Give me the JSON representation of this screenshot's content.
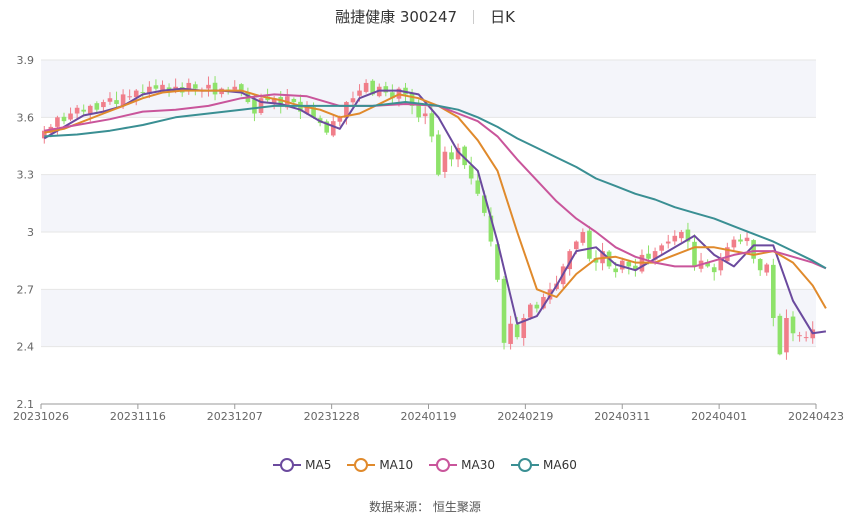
{
  "header": {
    "title": "融捷健康 300247",
    "period": "日K"
  },
  "source": "数据来源： 恒生聚源",
  "colors": {
    "up": "#f07e8a",
    "down": "#8ee26a",
    "grid": "#e6e6e6",
    "band": "#f4f5fa",
    "axis": "#9a9a9a",
    "text": "#666666"
  },
  "chart_data": {
    "type": "candlestick",
    "x_ticks": [
      "20231026",
      "20231116",
      "20231207",
      "20231228",
      "20240119",
      "20240219",
      "20240311",
      "20240401",
      "20240423"
    ],
    "ylim": [
      2.1,
      3.9
    ],
    "y_ticks": [
      "2.1",
      "2.4",
      "2.7",
      "3",
      "3.3",
      "3.6",
      "3.9"
    ],
    "grid": true,
    "legend_position": "bottom",
    "close": [
      3.53,
      3.55,
      3.6,
      3.58,
      3.62,
      3.65,
      3.63,
      3.66,
      3.64,
      3.68,
      3.7,
      3.67,
      3.72,
      3.71,
      3.74,
      3.73,
      3.76,
      3.75,
      3.77,
      3.74,
      3.76,
      3.73,
      3.78,
      3.75,
      3.74,
      3.77,
      3.72,
      3.75,
      3.74,
      3.76,
      3.73,
      3.68,
      3.62,
      3.7,
      3.69,
      3.7,
      3.66,
      3.71,
      3.68,
      3.63,
      3.66,
      3.6,
      3.57,
      3.52,
      3.58,
      3.6,
      3.68,
      3.7,
      3.74,
      3.78,
      3.72,
      3.76,
      3.73,
      3.7,
      3.75,
      3.72,
      3.66,
      3.6,
      3.62,
      3.5,
      3.3,
      3.42,
      3.38,
      3.44,
      3.35,
      3.28,
      3.2,
      3.1,
      2.95,
      2.75,
      2.42,
      2.52,
      2.45,
      2.55,
      2.62,
      2.6,
      2.66,
      2.7,
      2.73,
      2.82,
      2.9,
      2.95,
      3.0,
      2.86,
      2.84,
      2.9,
      2.82,
      2.79,
      2.85,
      2.82,
      2.8,
      2.88,
      2.86,
      2.9,
      2.93,
      2.95,
      2.98,
      3.0,
      2.95,
      2.82,
      2.85,
      2.82,
      2.79,
      2.86,
      2.92,
      2.96,
      2.95,
      2.97,
      2.86,
      2.8,
      2.83,
      2.55,
      2.36,
      2.55,
      2.47,
      2.46,
      2.45,
      2.49
    ],
    "series": [
      {
        "name": "MA5",
        "color": "#6b4a9e",
        "x": [
          0,
          3,
          6,
          9,
          12,
          15,
          18,
          21,
          24,
          27,
          30,
          33,
          36,
          39,
          42,
          45,
          48,
          51,
          54,
          57,
          60,
          63,
          66,
          69,
          72,
          75,
          78,
          81,
          84,
          87,
          90,
          93,
          96,
          99,
          102,
          105,
          108,
          111,
          114,
          117,
          119
        ],
        "y": [
          3.49,
          3.55,
          3.61,
          3.63,
          3.66,
          3.72,
          3.74,
          3.75,
          3.74,
          3.74,
          3.73,
          3.68,
          3.67,
          3.64,
          3.58,
          3.54,
          3.7,
          3.74,
          3.74,
          3.72,
          3.6,
          3.42,
          3.32,
          2.95,
          2.52,
          2.56,
          2.72,
          2.9,
          2.92,
          2.83,
          2.8,
          2.86,
          2.92,
          2.98,
          2.88,
          2.82,
          2.93,
          2.93,
          2.64,
          2.47,
          2.48
        ]
      },
      {
        "name": "MA10",
        "color": "#e08a2c",
        "x": [
          0,
          3,
          6,
          9,
          12,
          15,
          18,
          21,
          24,
          27,
          30,
          33,
          36,
          39,
          42,
          45,
          48,
          51,
          54,
          57,
          60,
          63,
          66,
          69,
          72,
          75,
          78,
          81,
          84,
          87,
          90,
          93,
          96,
          99,
          102,
          105,
          108,
          111,
          114,
          117,
          119
        ],
        "y": [
          3.52,
          3.54,
          3.58,
          3.62,
          3.66,
          3.7,
          3.73,
          3.74,
          3.74,
          3.74,
          3.74,
          3.71,
          3.69,
          3.66,
          3.64,
          3.6,
          3.62,
          3.67,
          3.72,
          3.7,
          3.66,
          3.6,
          3.48,
          3.32,
          3.0,
          2.7,
          2.66,
          2.78,
          2.86,
          2.87,
          2.84,
          2.84,
          2.88,
          2.92,
          2.92,
          2.9,
          2.88,
          2.9,
          2.84,
          2.72,
          2.6
        ]
      },
      {
        "name": "MA30",
        "color": "#c9559b",
        "x": [
          0,
          5,
          10,
          15,
          20,
          25,
          30,
          35,
          40,
          45,
          50,
          55,
          60,
          63,
          66,
          69,
          72,
          75,
          78,
          81,
          84,
          87,
          90,
          93,
          96,
          99,
          102,
          105,
          108,
          111,
          114,
          117,
          119
        ],
        "y": [
          3.53,
          3.56,
          3.59,
          3.63,
          3.64,
          3.66,
          3.7,
          3.72,
          3.71,
          3.66,
          3.66,
          3.67,
          3.66,
          3.62,
          3.58,
          3.5,
          3.38,
          3.27,
          3.16,
          3.07,
          3.0,
          2.92,
          2.87,
          2.84,
          2.82,
          2.82,
          2.85,
          2.88,
          2.9,
          2.9,
          2.87,
          2.84,
          2.81
        ]
      },
      {
        "name": "MA60",
        "color": "#3a8f93",
        "x": [
          0,
          5,
          10,
          15,
          20,
          25,
          30,
          35,
          40,
          45,
          50,
          55,
          60,
          63,
          66,
          69,
          72,
          75,
          78,
          81,
          84,
          87,
          90,
          93,
          96,
          99,
          102,
          105,
          108,
          111,
          114,
          117,
          119
        ],
        "y": [
          3.5,
          3.51,
          3.53,
          3.56,
          3.6,
          3.62,
          3.64,
          3.66,
          3.66,
          3.66,
          3.66,
          3.68,
          3.66,
          3.64,
          3.6,
          3.55,
          3.49,
          3.44,
          3.39,
          3.34,
          3.28,
          3.24,
          3.2,
          3.17,
          3.13,
          3.1,
          3.07,
          3.03,
          2.99,
          2.95,
          2.9,
          2.85,
          2.81
        ]
      }
    ]
  }
}
